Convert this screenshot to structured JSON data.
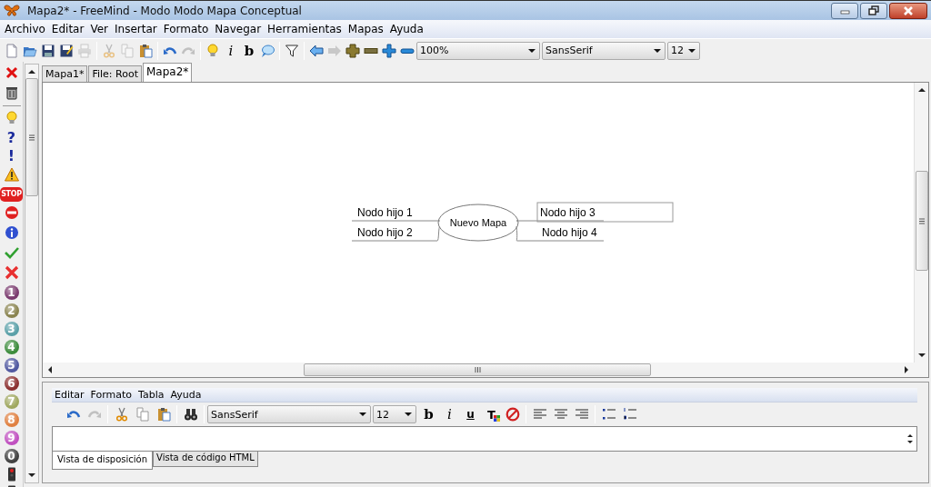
{
  "window": {
    "title": "Mapa2* - FreeMind - Modo Modo Mapa Conceptual"
  },
  "menu": [
    "Archivo",
    "Editar",
    "Ver",
    "Insertar",
    "Formato",
    "Navegar",
    "Herramientas",
    "Mapas",
    "Ayuda"
  ],
  "toolbar": [
    {
      "kind": "new",
      "disabled": false
    },
    {
      "kind": "open",
      "disabled": false
    },
    {
      "kind": "save",
      "disabled": false
    },
    {
      "kind": "saveas",
      "disabled": false
    },
    {
      "kind": "print",
      "disabled": true
    },
    {
      "kind": "sep"
    },
    {
      "kind": "cut",
      "disabled": true
    },
    {
      "kind": "copy",
      "disabled": true
    },
    {
      "kind": "paste",
      "disabled": false
    },
    {
      "kind": "sep"
    },
    {
      "kind": "undo",
      "disabled": false
    },
    {
      "kind": "redo",
      "disabled": true
    },
    {
      "kind": "sep"
    },
    {
      "kind": "bulb",
      "disabled": false
    },
    {
      "kind": "italic",
      "label": "i",
      "disabled": false
    },
    {
      "kind": "bold",
      "label": "b",
      "disabled": false
    },
    {
      "kind": "bubble",
      "disabled": false
    },
    {
      "kind": "sep"
    },
    {
      "kind": "filter",
      "disabled": false
    },
    {
      "kind": "sep"
    },
    {
      "kind": "back",
      "disabled": false
    },
    {
      "kind": "forward",
      "disabled": true
    },
    {
      "kind": "bigplus",
      "disabled": false
    },
    {
      "kind": "bigminus",
      "disabled": false
    },
    {
      "kind": "plus",
      "disabled": false
    },
    {
      "kind": "minus",
      "disabled": false
    },
    {
      "kind": "combo",
      "value": "100%"
    },
    {
      "kind": "combo",
      "value": "SansSerif"
    },
    {
      "kind": "combo",
      "value": "12"
    }
  ],
  "icon_palette": [
    {
      "kind": "remove"
    },
    {
      "kind": "trash"
    },
    {
      "kind": "sep"
    },
    {
      "kind": "bulb"
    },
    {
      "kind": "glyph",
      "label": "?",
      "color": "#1a2a9c"
    },
    {
      "kind": "glyph",
      "label": "!",
      "color": "#1a2a9c"
    },
    {
      "kind": "warning"
    },
    {
      "kind": "stop",
      "label": "STOP"
    },
    {
      "kind": "noentry"
    },
    {
      "kind": "info"
    },
    {
      "kind": "check"
    },
    {
      "kind": "cross"
    },
    {
      "kind": "number",
      "label": "1",
      "color": "#7a3a6e"
    },
    {
      "kind": "number",
      "label": "2",
      "color": "#8a8450"
    },
    {
      "kind": "number",
      "label": "3",
      "color": "#5aa0a8"
    },
    {
      "kind": "number",
      "label": "4",
      "color": "#3c8c3c"
    },
    {
      "kind": "number",
      "label": "5",
      "color": "#5058a0"
    },
    {
      "kind": "number",
      "label": "6",
      "color": "#8c3030"
    },
    {
      "kind": "number",
      "label": "7",
      "color": "#a0a860"
    },
    {
      "kind": "number",
      "label": "8",
      "color": "#e08040"
    },
    {
      "kind": "number",
      "label": "9",
      "color": "#c050c0"
    },
    {
      "kind": "number",
      "label": "0",
      "color": "#404040"
    },
    {
      "kind": "traffic"
    },
    {
      "kind": "traffic2"
    }
  ],
  "tabs": [
    {
      "label": "Mapa1*",
      "selected": false
    },
    {
      "label": "File: Root",
      "selected": false
    },
    {
      "label": "Mapa2*",
      "selected": true
    }
  ],
  "map": {
    "root": "Nuevo Mapa",
    "nodes": [
      {
        "text": "Nodo hijo 1",
        "selected": false
      },
      {
        "text": "Nodo hijo 2",
        "selected": false
      },
      {
        "text": "Nodo hijo 3",
        "selected": true
      },
      {
        "text": "Nodo hijo 4",
        "selected": false
      }
    ]
  },
  "note_editor": {
    "menu": [
      "Editar",
      "Formato",
      "Tabla",
      "Ayuda"
    ],
    "toolbar": [
      {
        "kind": "undo",
        "disabled": false
      },
      {
        "kind": "redo",
        "disabled": true
      },
      {
        "kind": "sep"
      },
      {
        "kind": "cut",
        "disabled": false
      },
      {
        "kind": "copy",
        "disabled": false
      },
      {
        "kind": "paste",
        "disabled": false
      },
      {
        "kind": "sep"
      },
      {
        "kind": "find",
        "disabled": false
      },
      {
        "kind": "sep"
      },
      {
        "kind": "combo",
        "value": "SansSerif"
      },
      {
        "kind": "combo",
        "value": "12"
      },
      {
        "kind": "bold",
        "label": "b",
        "disabled": false
      },
      {
        "kind": "italic",
        "label": "i",
        "disabled": false
      },
      {
        "kind": "underline",
        "label": "u",
        "disabled": false
      },
      {
        "kind": "textcolor",
        "label": "T",
        "disabled": false
      },
      {
        "kind": "clear",
        "disabled": false
      },
      {
        "kind": "sep"
      },
      {
        "kind": "alignleft",
        "disabled": false
      },
      {
        "kind": "aligncenter",
        "disabled": false
      },
      {
        "kind": "alignright",
        "disabled": false
      },
      {
        "kind": "sep"
      },
      {
        "kind": "bullets",
        "disabled": false
      },
      {
        "kind": "numbers",
        "disabled": false
      }
    ],
    "tabs": [
      {
        "label": "Vista de disposición",
        "selected": true
      },
      {
        "label": "Vista de código HTML",
        "selected": false
      }
    ]
  }
}
